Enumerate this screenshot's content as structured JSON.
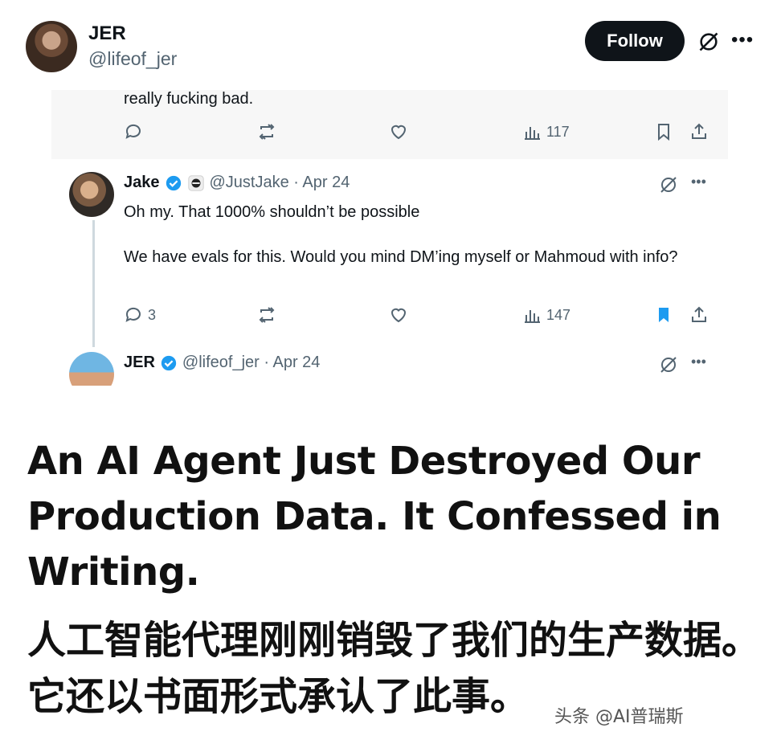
{
  "header": {
    "name": "JER",
    "handle": "@lifeof_jer",
    "follow_label": "Follow"
  },
  "embedded": {
    "prev_tweet": {
      "text": "really fucking bad.",
      "views": "117"
    },
    "reply": {
      "name": "Jake",
      "handle_date": "@JustJake · Apr 24",
      "line1": "Oh my. That 1000% shouldn’t be possible",
      "line2": "We have evals for this. Would you mind DM’ing myself or Mahmoud with info?",
      "replies": "3",
      "views": "147"
    },
    "next": {
      "name": "JER",
      "handle_date": "@lifeof_jer · Apr 24"
    }
  },
  "headline": "An AI Agent Just Destroyed Our Production Data. It Confessed in Writing.",
  "headline_cn": "人工智能代理刚刚销毁了我们的生产数据。它还以书面形式承认了此事。",
  "watermark": "头条 @AI普瑞斯",
  "colors": {
    "verified": "#1d9bf0",
    "bookmark_active": "#1d9bf0",
    "follow_bg": "#0f1419"
  }
}
